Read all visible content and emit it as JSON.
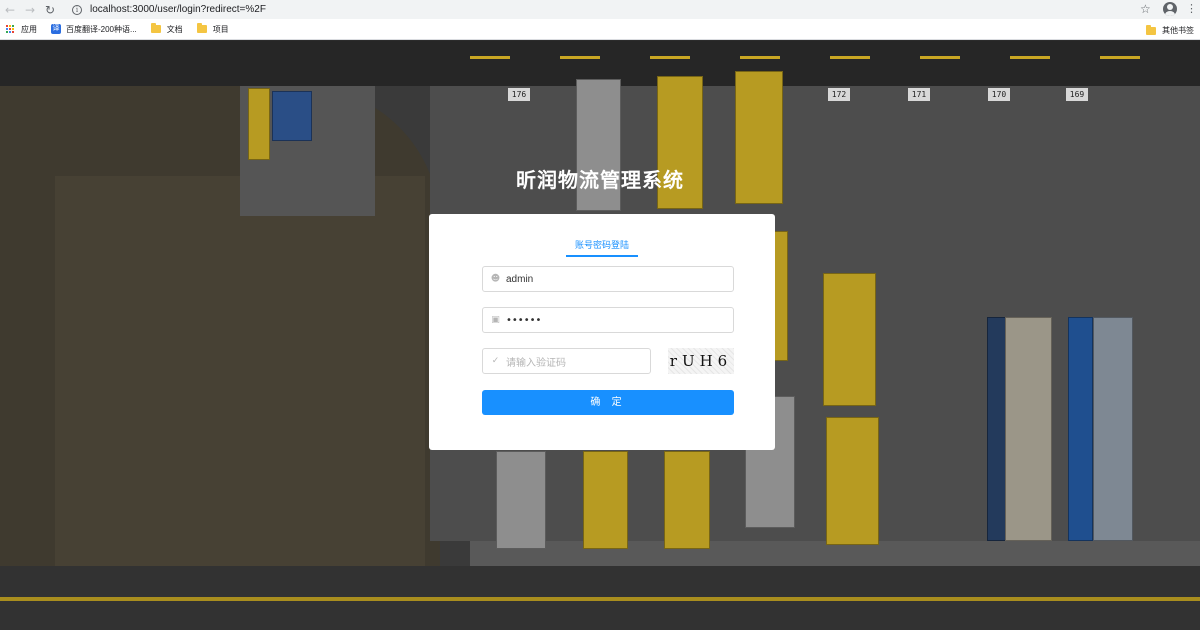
{
  "browser": {
    "url": "localhost:3000/user/login?redirect=%2F",
    "bookmarks": [
      {
        "label": "应用",
        "icon": "apps-icon"
      },
      {
        "label": "百度翻译-200种语...",
        "icon": "baidu-translate-icon"
      },
      {
        "label": "文档",
        "icon": "folder-icon"
      },
      {
        "label": "项目",
        "icon": "folder-icon"
      }
    ],
    "other_bookmarks": "其他书签",
    "baidu_badge": "译"
  },
  "yard": {
    "bays": [
      "176",
      "172",
      "171",
      "170",
      "169"
    ]
  },
  "login": {
    "system_title": "昕润物流管理系统",
    "tab_label": "账号密码登陆",
    "username_value": "admin",
    "password_mask": "••••••",
    "captcha_placeholder": "请输入验证码",
    "captcha_code": "rUH6",
    "submit_label": "确 定",
    "accent_color": "#1890ff"
  }
}
